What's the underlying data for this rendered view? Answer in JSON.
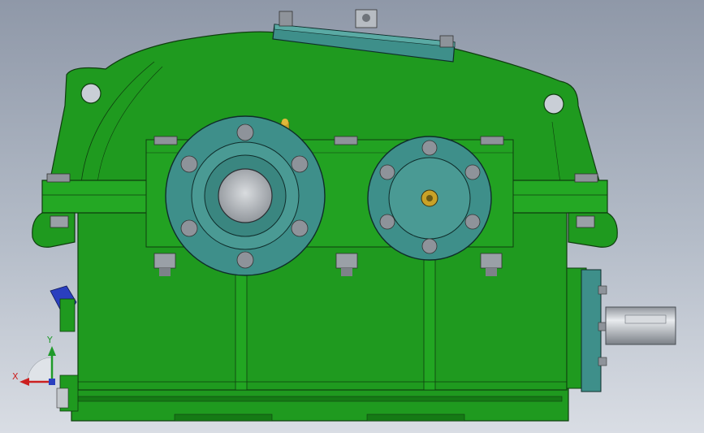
{
  "window": {
    "app": "",
    "view": "front",
    "background_top": "#8f98a8",
    "background_bottom": "#d9dde4"
  },
  "model": {
    "description_visible": false,
    "body_color": "#1f9a1f",
    "body_dark": "#157a15",
    "edge_color": "#0f3d0f",
    "cover_color": "#3e8f8a",
    "bolt_color": "#8e939a",
    "shaft_color": "#c3c7cc"
  },
  "triad": {
    "x_label": "X",
    "y_label": "Y",
    "x_color": "#cc2020",
    "y_color": "#1f9a2a",
    "z_color": "#2a3fbf"
  }
}
